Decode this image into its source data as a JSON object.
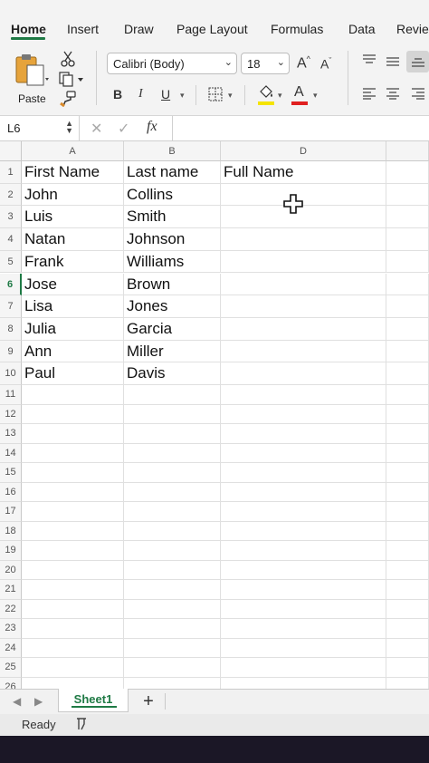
{
  "ribbon_tabs": [
    {
      "label": "Home",
      "active": true
    },
    {
      "label": "Insert"
    },
    {
      "label": "Draw"
    },
    {
      "label": "Page Layout"
    },
    {
      "label": "Formulas"
    },
    {
      "label": "Data"
    },
    {
      "label": "Revie"
    }
  ],
  "ribbon": {
    "paste_label": "Paste",
    "font_name": "Calibri (Body)",
    "font_size": "18",
    "grow_font": "A",
    "shrink_font": "A",
    "bold": "B",
    "italic": "I",
    "underline": "U",
    "font_color_letter": "A",
    "fill_color": "#f5e400",
    "font_color": "#e02020",
    "icons": [
      "clipboard-icon",
      "cut-icon",
      "copy-icon",
      "format-painter-icon",
      "borders-icon",
      "fill-bucket-icon",
      "align-top-icon",
      "align-middle-icon",
      "align-bottom-icon",
      "align-left-icon",
      "align-center-icon",
      "align-right-icon"
    ]
  },
  "formula_bar": {
    "name_box": "L6",
    "cancel": "✕",
    "enter": "✓",
    "fx": "fx",
    "formula": ""
  },
  "grid": {
    "columns": [
      "A",
      "B",
      "D"
    ],
    "rows": [
      "1",
      "2",
      "3",
      "4",
      "5",
      "6",
      "7",
      "8",
      "9",
      "10",
      "11",
      "12",
      "13",
      "14",
      "15",
      "16",
      "17",
      "18",
      "19",
      "20",
      "21",
      "22",
      "23",
      "24",
      "25",
      "26"
    ],
    "selected_row": "6",
    "cells": [
      [
        "First Name",
        "Last name",
        "Full Name"
      ],
      [
        "John",
        "Collins",
        ""
      ],
      [
        "Luis",
        "Smith",
        ""
      ],
      [
        "Natan",
        "Johnson",
        ""
      ],
      [
        "Frank",
        "Williams",
        ""
      ],
      [
        "Jose",
        "Brown",
        ""
      ],
      [
        "Lisa",
        "Jones",
        ""
      ],
      [
        "Julia",
        "Garcia",
        ""
      ],
      [
        "Ann",
        "Miller",
        ""
      ],
      [
        "Paul",
        "Davis",
        ""
      ]
    ]
  },
  "sheet_tabs": {
    "active": "Sheet1",
    "add": "+"
  },
  "status": {
    "text": "Ready"
  },
  "colors": {
    "accent": "#1f7a45",
    "ribbon_bg": "#f3f3f3"
  }
}
